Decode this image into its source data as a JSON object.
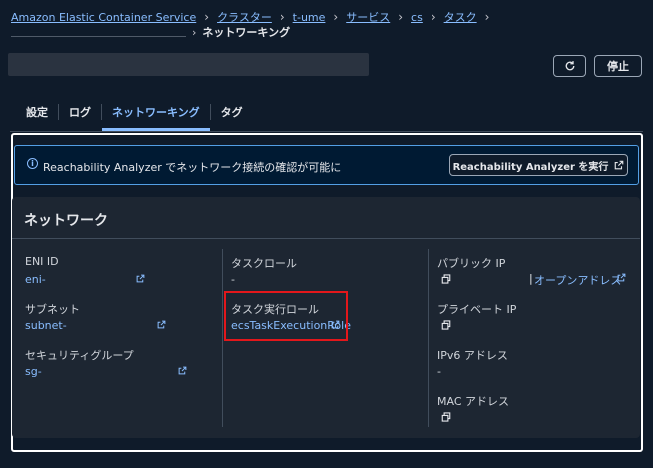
{
  "breadcrumb": {
    "items": [
      "Amazon Elastic Container Service",
      "クラスター",
      "t-ume",
      "サービス",
      "cs",
      "タスク"
    ],
    "current": "ネットワーキング"
  },
  "header": {
    "stop_label": "停止",
    "refresh_icon": "refresh-icon"
  },
  "tabs": [
    {
      "label": "設定"
    },
    {
      "label": "ログ"
    },
    {
      "label": "ネットワーキング",
      "active": true
    },
    {
      "label": "タグ"
    }
  ],
  "alert": {
    "message": "Reachability Analyzer でネットワーク接続の確認が可能に",
    "button_label": "Reachability Analyzer を実行"
  },
  "network": {
    "title": "ネットワーク",
    "eni": {
      "label": "ENI ID",
      "value": "eni-"
    },
    "subnet": {
      "label": "サブネット",
      "value": "subnet-"
    },
    "sg": {
      "label": "セキュリティグループ",
      "value": "sg-"
    },
    "task_role": {
      "label": "タスクロール",
      "value": "-"
    },
    "exec_role": {
      "label": "タスク実行ロール",
      "value": "ecsTaskExecutionRole"
    },
    "public_ip": {
      "label": "パブリック IP",
      "open_address": "オープンアドレス",
      "separator": "|"
    },
    "private_ip": {
      "label": "プライベート IP"
    },
    "ipv6": {
      "label": "IPv6 アドレス",
      "value": "-"
    },
    "mac": {
      "label": "MAC アドレス"
    }
  },
  "colors": {
    "link": "#89bdff",
    "highlight_box": "#e3171b",
    "background": "#0f1b2a"
  }
}
